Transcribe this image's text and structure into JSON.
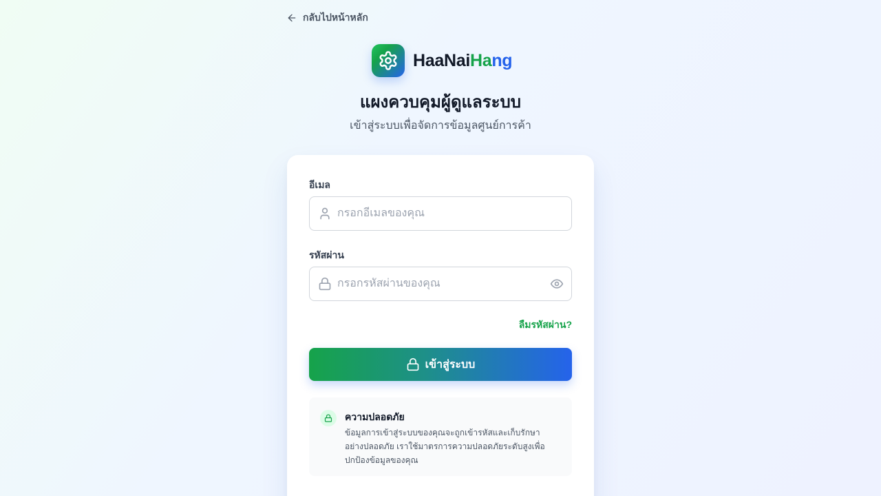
{
  "nav": {
    "back_label": "กลับไปหน้าหลัก"
  },
  "brand": {
    "part1": "HaaNai",
    "part2": "Ha",
    "part3": "ng",
    "logo_icon": "gear-icon"
  },
  "header": {
    "title": "แผงควบคุมผู้ดูแลระบบ",
    "subtitle": "เข้าสู่ระบบเพื่อจัดการข้อมูลศูนย์การค้า"
  },
  "form": {
    "email_label": "อีเมล",
    "email_value": "",
    "email_placeholder": "กรอกอีเมลของคุณ",
    "password_label": "รหัสผ่าน",
    "password_value": "",
    "password_placeholder": "กรอกรหัสผ่านของคุณ",
    "forgot_label": "ลืมรหัสผ่าน?",
    "submit_label": "เข้าสู่ระบบ"
  },
  "notice": {
    "title": "ความปลอดภัย",
    "body": "ข้อมูลการเข้าสู่ระบบของคุณจะถูกเข้ารหัสและเก็บรักษาอย่างปลอดภัย เราใช้มาตรการความปลอดภัยระดับสูงเพื่อปกป้องข้อมูลของคุณ"
  },
  "colors": {
    "brand_green": "#16a34a",
    "brand_blue": "#2563eb",
    "text_dark": "#111827",
    "text_muted": "#4b5563"
  }
}
